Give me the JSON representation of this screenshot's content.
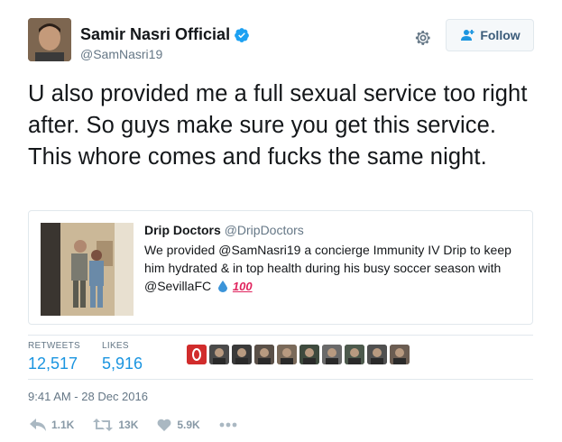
{
  "author": {
    "display_name": "Samir Nasri Official",
    "handle": "@SamNasri19",
    "verified_icon": "verified-badge-icon"
  },
  "follow_button": {
    "label": "Follow",
    "icon": "add-user-icon"
  },
  "settings_icon": "gear-icon",
  "tweet": {
    "text": "U also provided me a full sexual service too right after. So guys make sure you get this service. This whore comes and fucks the same night."
  },
  "quoted_tweet": {
    "name": "Drip Doctors",
    "handle": "@DripDoctors",
    "text": "We provided @SamNasri19 a concierge Immunity IV Drip to keep him hydrated & in top health during his busy soccer season with @SevillaFC",
    "emoji_100": "100"
  },
  "stats": {
    "retweets_label": "RETWEETS",
    "retweets_value": "12,517",
    "likes_label": "LIKES",
    "likes_value": "5,916"
  },
  "likers": [
    "#d12c2c",
    "#4a4a4a",
    "#3a3a3a",
    "#5a5048",
    "#7a6a5a",
    "#3e4a3e",
    "#6a6a6a",
    "#4d5a4d",
    "#505050",
    "#6b5d52"
  ],
  "timestamp": "9:41 AM - 28 Dec 2016",
  "actions": {
    "reply_count": "1.1K",
    "retweet_count": "13K",
    "like_count": "5.9K"
  },
  "colors": {
    "accent": "#1b95e0",
    "secondary_text": "#657786",
    "border": "#e1e8ed"
  }
}
